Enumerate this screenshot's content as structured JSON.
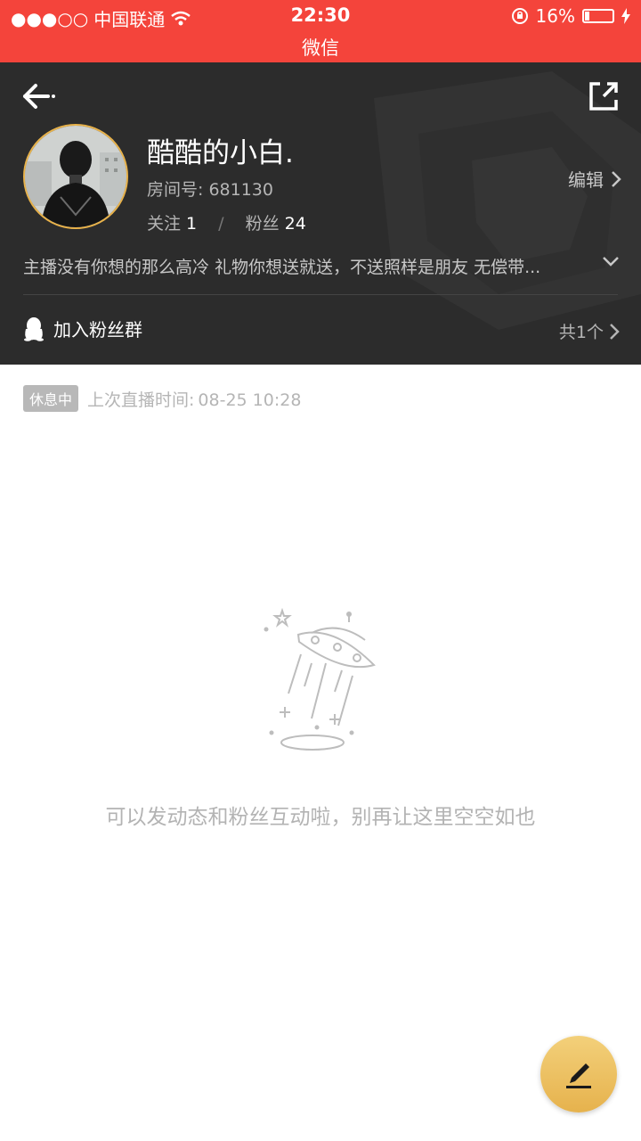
{
  "status_bar": {
    "signal": "●●●○○",
    "carrier": "中国联通",
    "time": "22:30",
    "app_name": "微信",
    "battery_text": "16%",
    "battery_level": 0.16,
    "icons": [
      "wifi-icon",
      "orientation-lock-icon",
      "battery-icon",
      "charging-icon"
    ]
  },
  "profile": {
    "name": "酷酷的小白.",
    "room_label": "房间号:",
    "room_number": "681130",
    "follow_label": "关注",
    "follow_count": "1",
    "separator": "/",
    "fans_label": "粉丝",
    "fans_count": "24",
    "edit_label": "编辑",
    "bio": "主播没有你想的那么高冷 礼物你想送就送，不送照样是朋友 无偿带...",
    "fan_group_label": "加入粉丝群",
    "fan_group_count": "共1个"
  },
  "live": {
    "badge": "休息中",
    "last_live_label": "上次直播时间:",
    "last_live_time": "08-25 10:28"
  },
  "empty_state": {
    "text": "可以发动态和粉丝互动啦，别再让这里空空如也"
  },
  "colors": {
    "status_bar": "#f4443b",
    "header_bg": "#2c2c2c",
    "accent": "#e8b24a"
  }
}
